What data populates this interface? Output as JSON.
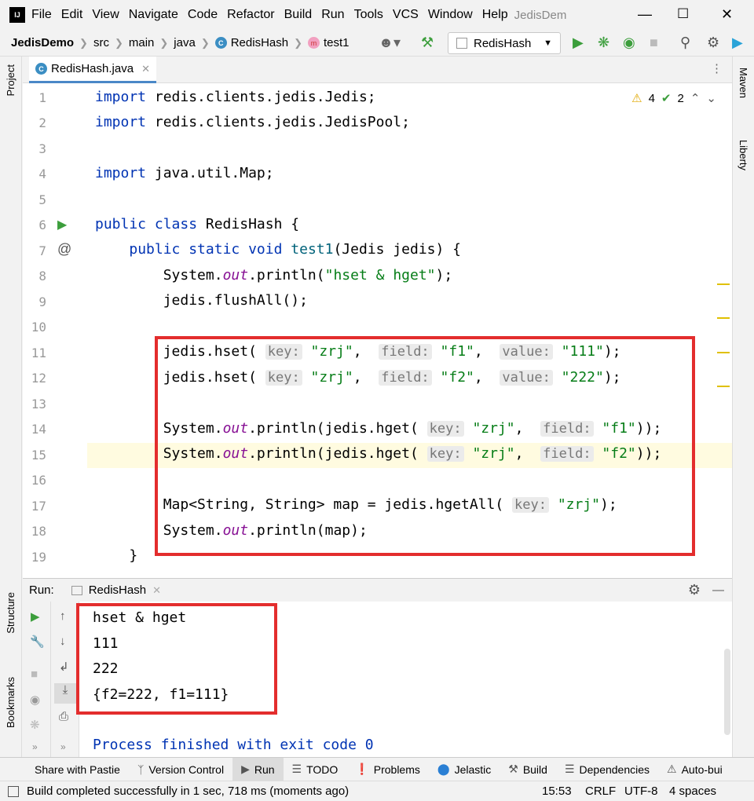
{
  "menubar": {
    "items": [
      "File",
      "Edit",
      "View",
      "Navigate",
      "Code",
      "Refactor",
      "Build",
      "Run",
      "Tools",
      "VCS",
      "Window",
      "Help"
    ],
    "title": "JedisDem"
  },
  "navbar": {
    "project": "JedisDemo",
    "crumbs": [
      "src",
      "main",
      "java",
      "RedisHash",
      "test1"
    ],
    "run_config": "RedisHash"
  },
  "left_strip": {
    "project": "Project",
    "structure": "Structure",
    "bookmarks": "Bookmarks"
  },
  "right_strip": {
    "maven": "Maven",
    "liberty": "Liberty"
  },
  "editor": {
    "tab": "RedisHash.java",
    "warnings": "4",
    "weak_warnings": "2",
    "line_numbers": [
      "1",
      "2",
      "3",
      "4",
      "5",
      "6",
      "7",
      "8",
      "9",
      "10",
      "11",
      "12",
      "13",
      "14",
      "15",
      "16",
      "17",
      "18",
      "19"
    ]
  },
  "run_panel": {
    "label": "Run:",
    "tab": "RedisHash",
    "output": [
      "hset & hget",
      "111",
      "222",
      "{f2=222, f1=111}"
    ],
    "finished": "Process finished with exit code 0"
  },
  "bottom_tabs": [
    "Share with Pastie",
    "Version Control",
    "Run",
    "TODO",
    "Problems",
    "Jelastic",
    "Build",
    "Dependencies",
    "Auto-bui"
  ],
  "statusbar": {
    "message": "Build completed successfully in 1 sec, 718 ms (moments ago)",
    "position": "15:53",
    "line_sep": "CRLF",
    "encoding": "UTF-8",
    "indent": "4 spaces"
  },
  "colors": {
    "keyword": "#0033b3",
    "string": "#067d17",
    "field": "#871094",
    "highlight_box": "#e32d2d"
  }
}
